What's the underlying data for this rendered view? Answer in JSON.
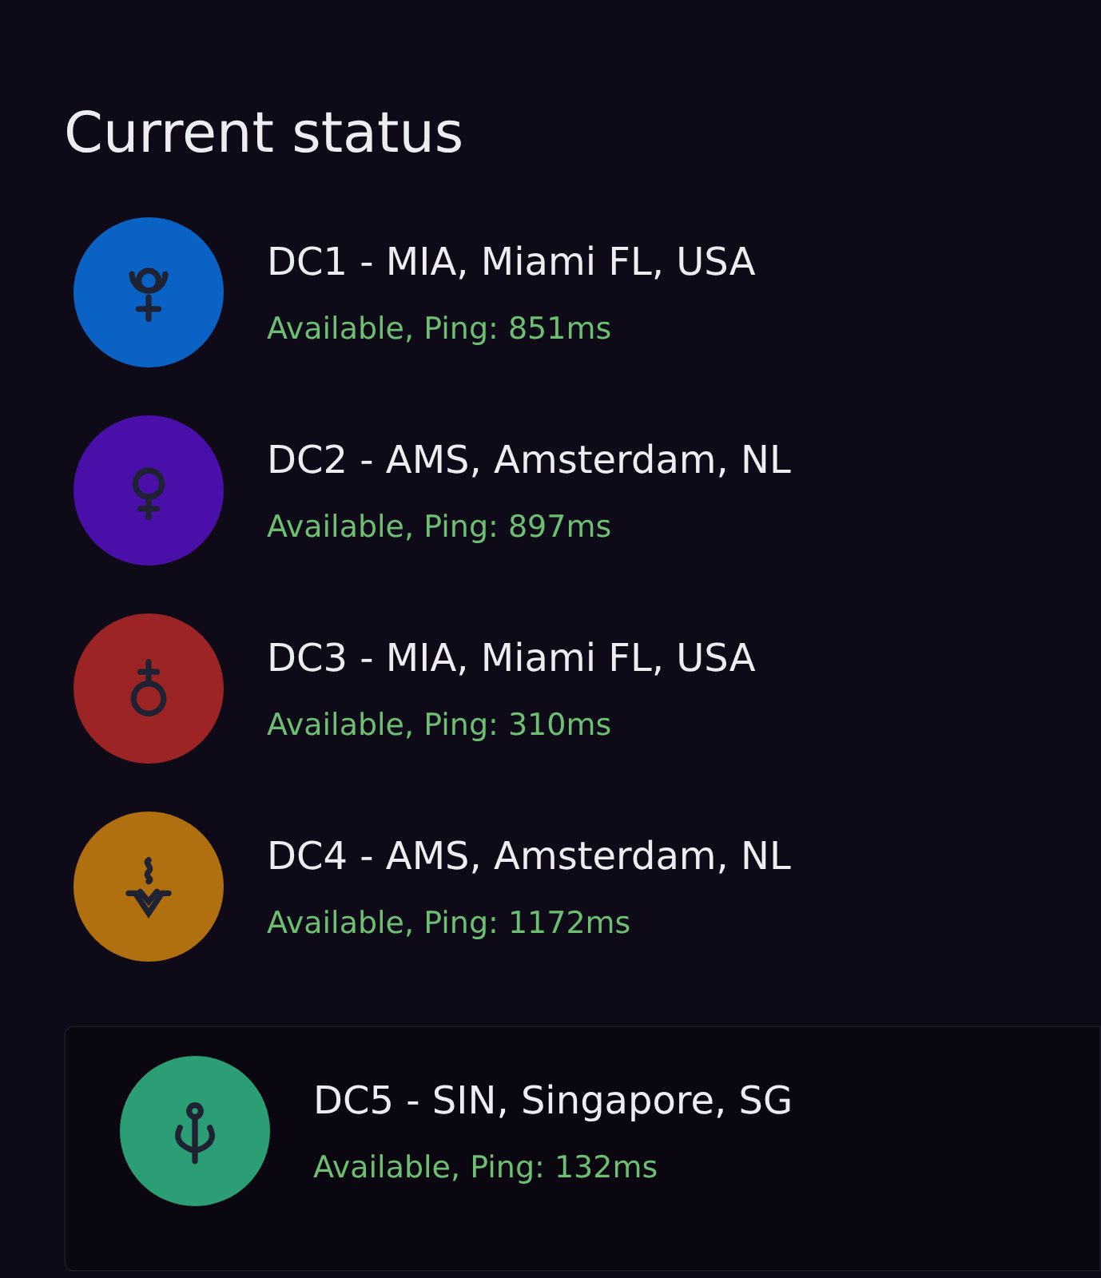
{
  "title": "Current status",
  "datacenters": [
    {
      "name": "DC1 - MIA, Miami FL, USA",
      "status": "Available, Ping: 851ms",
      "color": "#0a62c4",
      "kind": "pluto",
      "selected": false
    },
    {
      "name": "DC2 - AMS, Amsterdam, NL",
      "status": "Available, Ping: 897ms",
      "color": "#4a0fa8",
      "kind": "venus",
      "selected": false
    },
    {
      "name": "DC3 - MIA, Miami FL, USA",
      "status": "Available, Ping: 310ms",
      "color": "#9c2424",
      "kind": "mars",
      "selected": false
    },
    {
      "name": "DC4 - AMS, Amsterdam, NL",
      "status": "Available, Ping: 1172ms",
      "color": "#b0700f",
      "kind": "ceres",
      "selected": false
    },
    {
      "name": "DC5 - SIN, Singapore, SG",
      "status": "Available, Ping: 132ms",
      "color": "#2b9e76",
      "kind": "neptune",
      "selected": true
    }
  ]
}
